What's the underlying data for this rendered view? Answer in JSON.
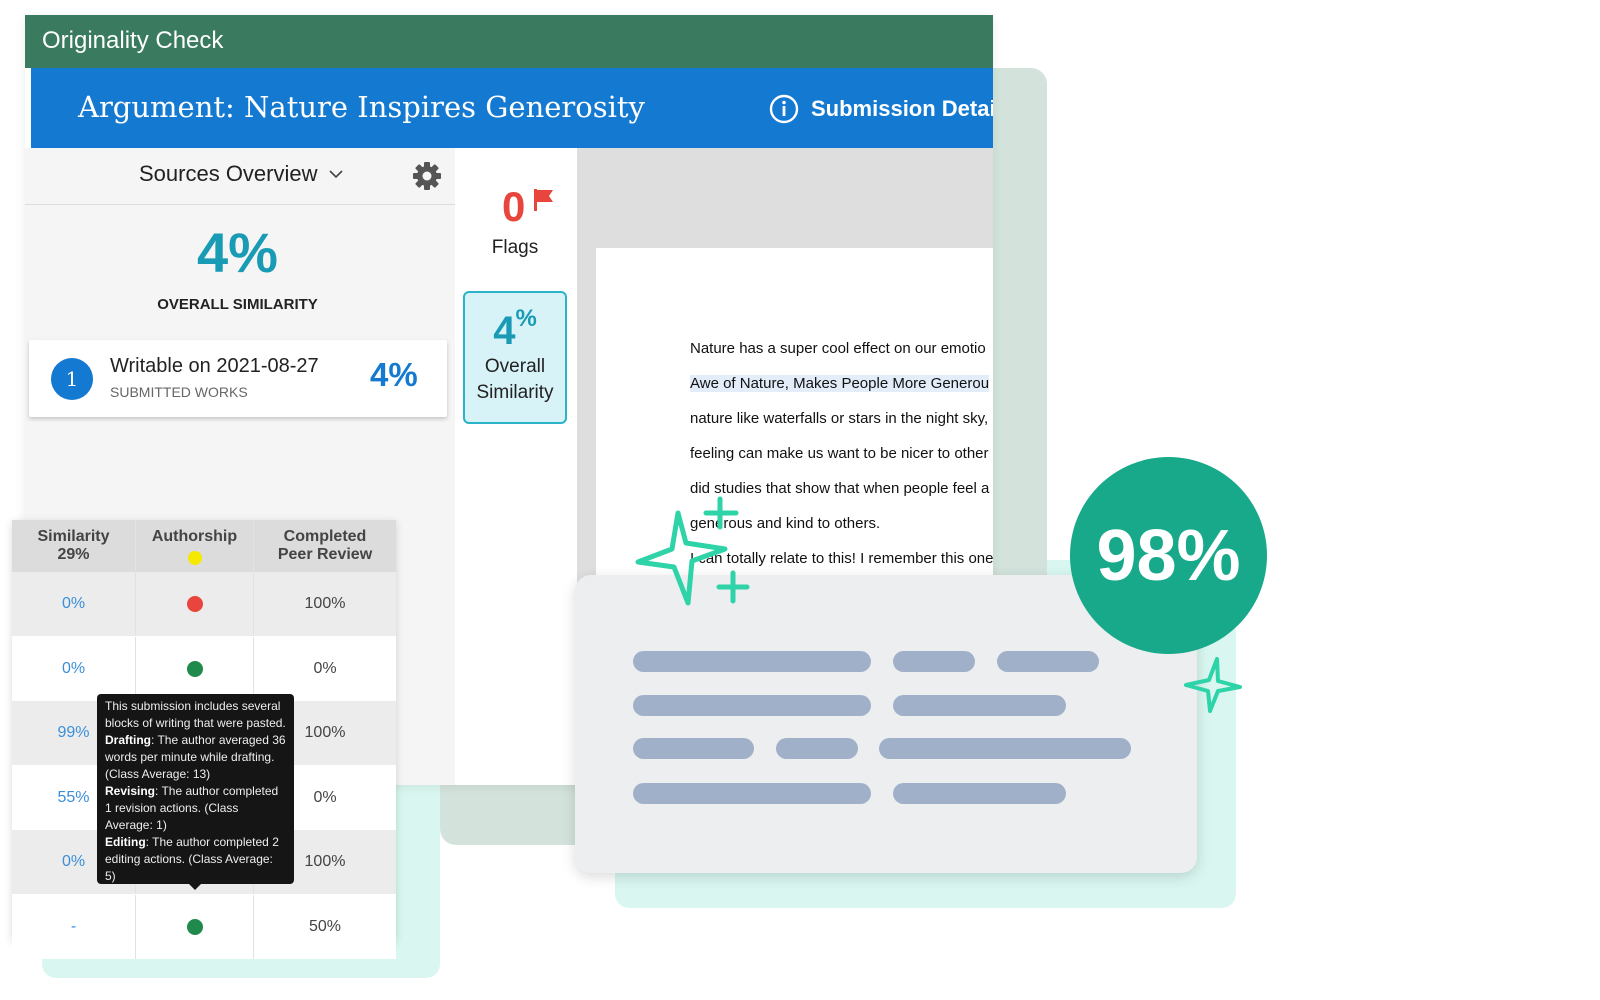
{
  "app": {
    "title": "Originality Check"
  },
  "header": {
    "title": "Argument: Nature Inspires Generosity",
    "details_label": "Submission Detai"
  },
  "sources": {
    "dropdown_label": "Sources Overview",
    "overall_pct": "4%",
    "overall_label": "OVERALL SIMILARITY",
    "items": [
      {
        "index": "1",
        "title": "Writable on 2021-08-27",
        "subtitle": "SUBMITTED WORKS",
        "pct": "4%"
      }
    ]
  },
  "flags": {
    "count": "0",
    "label": "Flags",
    "flag_color": "#e8453c"
  },
  "similarity_card": {
    "value": "4",
    "unit": "%",
    "label_line1": "Overall",
    "label_line2": "Similarity"
  },
  "document": {
    "lines": [
      "Nature has a super cool effect on our emotio",
      "Awe of Nature, Makes People More Generou",
      "nature like waterfalls or stars in the night sky,",
      "feeling can make us want to be nicer to other",
      "did studies that show that when people feel a",
      "generous and kind to others.",
      "I can totally relate to this! I remember this one"
    ]
  },
  "table": {
    "headers": [
      {
        "line1": "Similarity",
        "line2": "29%"
      },
      {
        "line1": "Authorship",
        "dot": "#f5e900"
      },
      {
        "line1": "Completed",
        "line2": "Peer Review"
      }
    ],
    "rows": [
      {
        "similarity": "0%",
        "dot": "#e8453c",
        "review": "100%"
      },
      {
        "similarity": "0%",
        "dot": "#1f8a4c",
        "review": "0%"
      },
      {
        "similarity": "99%",
        "dot": "#1f8a4c",
        "review": "100%"
      },
      {
        "similarity": "55%",
        "dot": "#1f8a4c",
        "review": "0%"
      },
      {
        "similarity": "0%",
        "dot": "#1f8a4c",
        "review": "100%"
      },
      {
        "similarity": "-",
        "dot": "#1f8a4c",
        "review": "50%"
      }
    ]
  },
  "tooltip": {
    "intro": "This submission includes several blocks of writing that were pasted.",
    "drafting_label": "Drafting",
    "drafting": ": The author averaged 36 words per minute while drafting. (Class Average: 13)",
    "revising_label": "Revising",
    "revising": ": The author completed 1 revision actions. (Class Average: 1)",
    "editing_label": "Editing",
    "editing": ": The author completed 2 editing actions. (Class Average: 5)"
  },
  "score_badge": {
    "value": "98%",
    "color": "#17a98a"
  },
  "colors": {
    "topbar": "#3a7a5e",
    "header": "#1479d0",
    "accent": "#1a9bb5",
    "sparkle": "#2ed3a8"
  }
}
